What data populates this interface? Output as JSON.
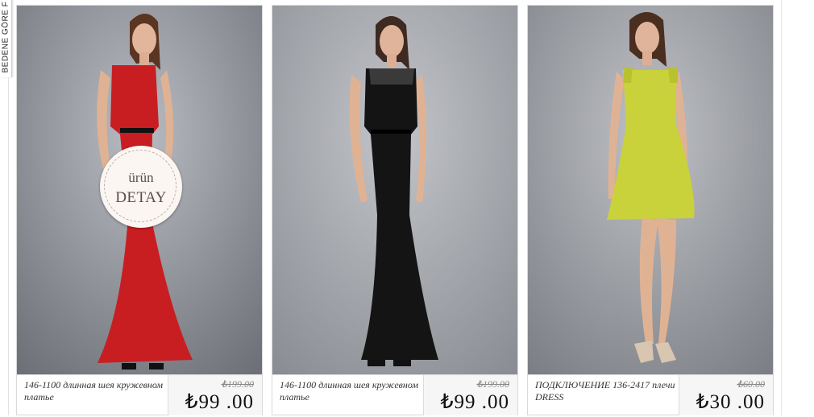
{
  "side_tab": {
    "label": "BEDENE GÖRE F"
  },
  "badge": {
    "line1": "ürün",
    "line2": "DETAY"
  },
  "products": [
    {
      "name": "146-1100 длинная шея кружевном платье",
      "old_price": "₺199.00",
      "new_price": "₺99 .00",
      "dress_color": "#c81e22",
      "image_icon": "red-long-dress-photo"
    },
    {
      "name": "146-1100 длинная шея кружевном платье",
      "old_price": "₺199.00",
      "new_price": "₺99 .00",
      "dress_color": "#141414",
      "image_icon": "black-long-dress-photo"
    },
    {
      "name": "ПОДКЛЮЧЕНИЕ 136-2417 плечи DRESS",
      "old_price": "₺60.00",
      "new_price": "₺30 .00",
      "dress_color": "#c9d23a",
      "image_icon": "lime-short-dress-photo"
    }
  ]
}
